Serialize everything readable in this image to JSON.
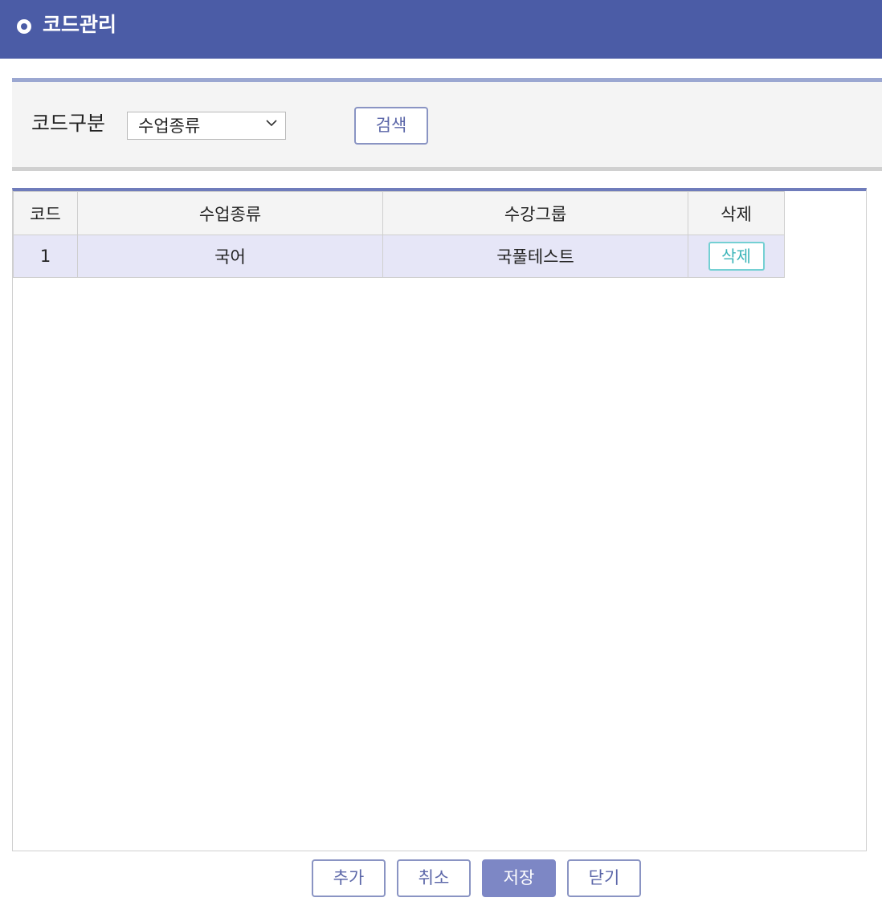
{
  "header": {
    "title": "코드관리"
  },
  "search": {
    "label": "코드구분",
    "select_value": "수업종류",
    "search_button": "검색"
  },
  "table": {
    "columns": [
      "코드",
      "수업종류",
      "수강그룹",
      "삭제"
    ],
    "rows": [
      {
        "code": "1",
        "kind": "국어",
        "group": "국풀테스트",
        "delete_label": "삭제"
      }
    ]
  },
  "footer": {
    "add": "추가",
    "cancel": "취소",
    "save": "저장",
    "close": "닫기"
  },
  "colors": {
    "header_bg": "#4b5ca6",
    "accent_border": "#9ba7d1",
    "row_bg": "#e6e6f7",
    "save_button_bg": "#7d87c5",
    "delete_button_border": "#74d0d3"
  },
  "icons": {
    "header_bullet": "circle-bullet-icon",
    "select_arrow": "chevron-down-icon"
  }
}
